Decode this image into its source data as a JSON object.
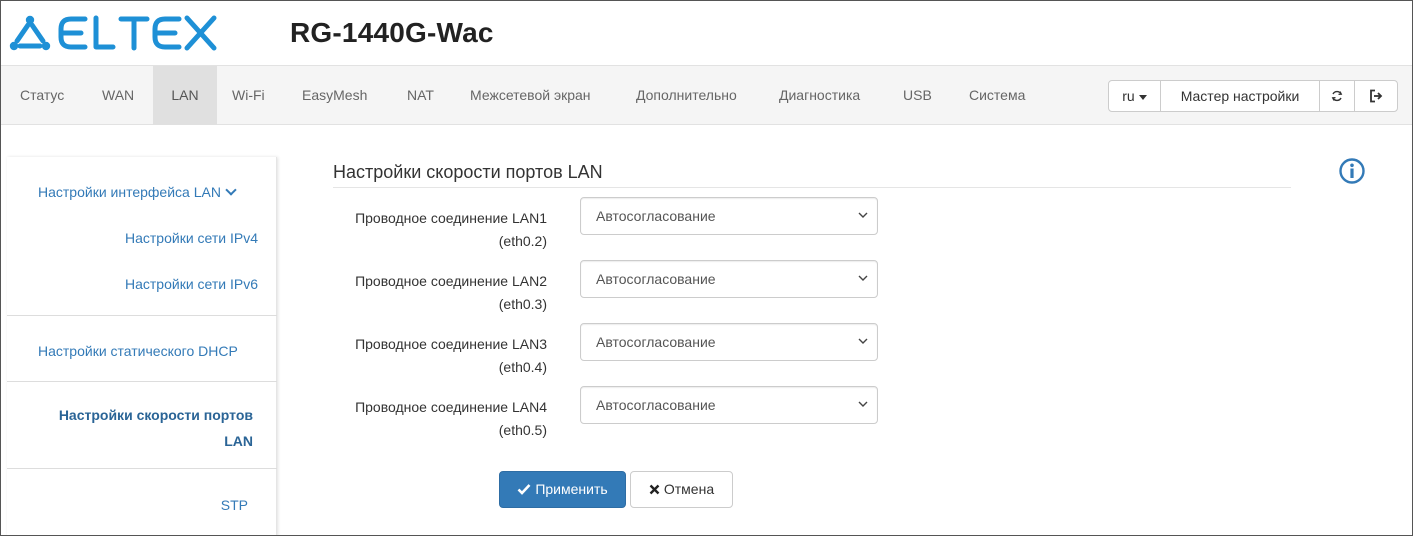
{
  "brand": {
    "logo_text": "ELTEX",
    "logo_color": "#1e90d6",
    "device": "RG-1440G-Wac"
  },
  "nav": {
    "items": [
      {
        "label": "Статус"
      },
      {
        "label": "WAN"
      },
      {
        "label": "LAN",
        "active": true
      },
      {
        "label": "Wi-Fi"
      },
      {
        "label": "EasyMesh"
      },
      {
        "label": "NAT"
      },
      {
        "label": "Межсетевой экран"
      },
      {
        "label": "Дополнительно"
      },
      {
        "label": "Диагностика"
      },
      {
        "label": "USB"
      },
      {
        "label": "Система"
      }
    ],
    "language": "ru",
    "wizard": "Мастер настройки",
    "refresh_icon": "refresh-icon",
    "logout_icon": "logout-icon"
  },
  "sidebar": {
    "group_lan": "Настройки интерфейса LAN",
    "ipv4": "Настройки сети IPv4",
    "ipv6": "Настройки сети IPv6",
    "static_dhcp": "Настройки статического DHCP",
    "port_speed_line1": "Настройки скорости портов",
    "port_speed_line2": "LAN",
    "stp": "STP"
  },
  "main": {
    "title": "Настройки скорости портов LAN",
    "info_icon": "info-icon",
    "rows": [
      {
        "label_line1": "Проводное соединение LAN1",
        "label_line2": "(eth0.2)",
        "value": "Автосогласование"
      },
      {
        "label_line1": "Проводное соединение LAN2",
        "label_line2": "(eth0.3)",
        "value": "Автосогласование"
      },
      {
        "label_line1": "Проводное соединение LAN3",
        "label_line2": "(eth0.4)",
        "value": "Автосогласование"
      },
      {
        "label_line1": "Проводное соединение LAN4",
        "label_line2": "(eth0.5)",
        "value": "Автосогласование"
      }
    ],
    "apply": "Применить",
    "cancel": "Отмена"
  },
  "colors": {
    "accent": "#337ab7",
    "link": "#337ab7",
    "nav_bg": "#f5f5f5",
    "nav_active_bg": "#e0e0e0"
  }
}
